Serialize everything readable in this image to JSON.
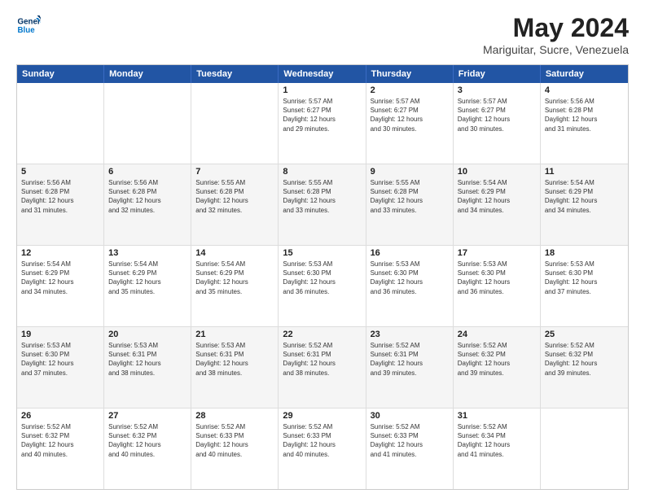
{
  "logo": {
    "line1": "General",
    "line2": "Blue"
  },
  "title": "May 2024",
  "subtitle": "Mariguitar, Sucre, Venezuela",
  "header_days": [
    "Sunday",
    "Monday",
    "Tuesday",
    "Wednesday",
    "Thursday",
    "Friday",
    "Saturday"
  ],
  "weeks": [
    {
      "alt": false,
      "days": [
        {
          "num": "",
          "info": ""
        },
        {
          "num": "",
          "info": ""
        },
        {
          "num": "",
          "info": ""
        },
        {
          "num": "1",
          "info": "Sunrise: 5:57 AM\nSunset: 6:27 PM\nDaylight: 12 hours\nand 29 minutes."
        },
        {
          "num": "2",
          "info": "Sunrise: 5:57 AM\nSunset: 6:27 PM\nDaylight: 12 hours\nand 30 minutes."
        },
        {
          "num": "3",
          "info": "Sunrise: 5:57 AM\nSunset: 6:27 PM\nDaylight: 12 hours\nand 30 minutes."
        },
        {
          "num": "4",
          "info": "Sunrise: 5:56 AM\nSunset: 6:28 PM\nDaylight: 12 hours\nand 31 minutes."
        }
      ]
    },
    {
      "alt": true,
      "days": [
        {
          "num": "5",
          "info": "Sunrise: 5:56 AM\nSunset: 6:28 PM\nDaylight: 12 hours\nand 31 minutes."
        },
        {
          "num": "6",
          "info": "Sunrise: 5:56 AM\nSunset: 6:28 PM\nDaylight: 12 hours\nand 32 minutes."
        },
        {
          "num": "7",
          "info": "Sunrise: 5:55 AM\nSunset: 6:28 PM\nDaylight: 12 hours\nand 32 minutes."
        },
        {
          "num": "8",
          "info": "Sunrise: 5:55 AM\nSunset: 6:28 PM\nDaylight: 12 hours\nand 33 minutes."
        },
        {
          "num": "9",
          "info": "Sunrise: 5:55 AM\nSunset: 6:28 PM\nDaylight: 12 hours\nand 33 minutes."
        },
        {
          "num": "10",
          "info": "Sunrise: 5:54 AM\nSunset: 6:29 PM\nDaylight: 12 hours\nand 34 minutes."
        },
        {
          "num": "11",
          "info": "Sunrise: 5:54 AM\nSunset: 6:29 PM\nDaylight: 12 hours\nand 34 minutes."
        }
      ]
    },
    {
      "alt": false,
      "days": [
        {
          "num": "12",
          "info": "Sunrise: 5:54 AM\nSunset: 6:29 PM\nDaylight: 12 hours\nand 34 minutes."
        },
        {
          "num": "13",
          "info": "Sunrise: 5:54 AM\nSunset: 6:29 PM\nDaylight: 12 hours\nand 35 minutes."
        },
        {
          "num": "14",
          "info": "Sunrise: 5:54 AM\nSunset: 6:29 PM\nDaylight: 12 hours\nand 35 minutes."
        },
        {
          "num": "15",
          "info": "Sunrise: 5:53 AM\nSunset: 6:30 PM\nDaylight: 12 hours\nand 36 minutes."
        },
        {
          "num": "16",
          "info": "Sunrise: 5:53 AM\nSunset: 6:30 PM\nDaylight: 12 hours\nand 36 minutes."
        },
        {
          "num": "17",
          "info": "Sunrise: 5:53 AM\nSunset: 6:30 PM\nDaylight: 12 hours\nand 36 minutes."
        },
        {
          "num": "18",
          "info": "Sunrise: 5:53 AM\nSunset: 6:30 PM\nDaylight: 12 hours\nand 37 minutes."
        }
      ]
    },
    {
      "alt": true,
      "days": [
        {
          "num": "19",
          "info": "Sunrise: 5:53 AM\nSunset: 6:30 PM\nDaylight: 12 hours\nand 37 minutes."
        },
        {
          "num": "20",
          "info": "Sunrise: 5:53 AM\nSunset: 6:31 PM\nDaylight: 12 hours\nand 38 minutes."
        },
        {
          "num": "21",
          "info": "Sunrise: 5:53 AM\nSunset: 6:31 PM\nDaylight: 12 hours\nand 38 minutes."
        },
        {
          "num": "22",
          "info": "Sunrise: 5:52 AM\nSunset: 6:31 PM\nDaylight: 12 hours\nand 38 minutes."
        },
        {
          "num": "23",
          "info": "Sunrise: 5:52 AM\nSunset: 6:31 PM\nDaylight: 12 hours\nand 39 minutes."
        },
        {
          "num": "24",
          "info": "Sunrise: 5:52 AM\nSunset: 6:32 PM\nDaylight: 12 hours\nand 39 minutes."
        },
        {
          "num": "25",
          "info": "Sunrise: 5:52 AM\nSunset: 6:32 PM\nDaylight: 12 hours\nand 39 minutes."
        }
      ]
    },
    {
      "alt": false,
      "days": [
        {
          "num": "26",
          "info": "Sunrise: 5:52 AM\nSunset: 6:32 PM\nDaylight: 12 hours\nand 40 minutes."
        },
        {
          "num": "27",
          "info": "Sunrise: 5:52 AM\nSunset: 6:32 PM\nDaylight: 12 hours\nand 40 minutes."
        },
        {
          "num": "28",
          "info": "Sunrise: 5:52 AM\nSunset: 6:33 PM\nDaylight: 12 hours\nand 40 minutes."
        },
        {
          "num": "29",
          "info": "Sunrise: 5:52 AM\nSunset: 6:33 PM\nDaylight: 12 hours\nand 40 minutes."
        },
        {
          "num": "30",
          "info": "Sunrise: 5:52 AM\nSunset: 6:33 PM\nDaylight: 12 hours\nand 41 minutes."
        },
        {
          "num": "31",
          "info": "Sunrise: 5:52 AM\nSunset: 6:34 PM\nDaylight: 12 hours\nand 41 minutes."
        },
        {
          "num": "",
          "info": ""
        }
      ]
    }
  ]
}
